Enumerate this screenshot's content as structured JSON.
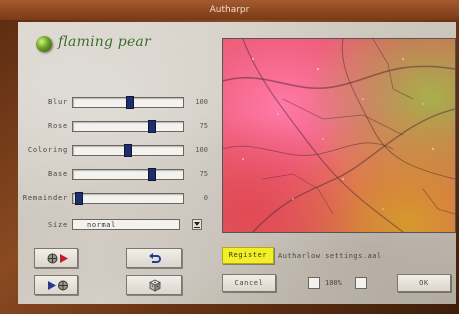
{
  "window": {
    "title": "Autharpr"
  },
  "logo": {
    "text": "flaming pear"
  },
  "sliders": [
    {
      "label": "Blur",
      "value": "100",
      "level": 0.52
    },
    {
      "label": "Rose",
      "value": "75",
      "level": 0.74
    },
    {
      "label": "Coloring",
      "value": "100",
      "level": 0.5
    },
    {
      "label": "Base",
      "value": "75",
      "level": 0.74
    },
    {
      "label": "Remainder",
      "value": "0",
      "level": 0.02
    }
  ],
  "size": {
    "label": "Size",
    "value": "normal"
  },
  "buttons": {
    "register": "Register",
    "cancel": "Cancel",
    "ok": "OK"
  },
  "settings_file": "Autharlow settings.aal",
  "checkbox": {
    "label": "100%"
  },
  "colors": {
    "accent": "#f2ef2a",
    "panel": "#d2ccc3",
    "thumb": "#1f2f6a",
    "frame": "#6a3414"
  },
  "icons": {
    "logo": "flaming-pear-ball-icon",
    "load_preset": "load-preset-icon",
    "save_preset": "save-preset-icon",
    "undo": "undo-arrow-icon",
    "randomize": "dice-icon"
  }
}
